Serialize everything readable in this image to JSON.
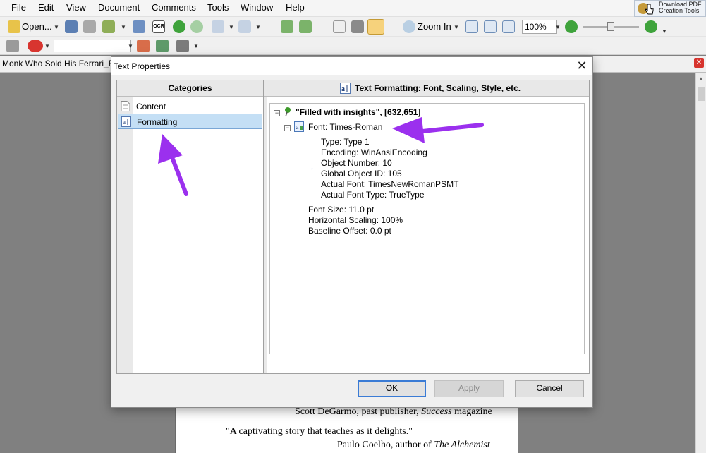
{
  "menubar": {
    "items": [
      "File",
      "Edit",
      "View",
      "Document",
      "Comments",
      "Tools",
      "Window",
      "Help"
    ],
    "download": {
      "line1": "Download PDF",
      "line2": "Creation Tools"
    }
  },
  "toolbar": {
    "open_label": "Open...",
    "zoom_in_label": "Zoom In",
    "zoom_value": "100%"
  },
  "document_tab": {
    "title": "Monk Who Sold His Ferrari_R"
  },
  "page_text": {
    "line1_plain": "Scott DeGarmo, past publisher, ",
    "line1_italic": "Success",
    "line1_end": " magazine",
    "line2": "\"A captivating story that teaches as it delights.\"",
    "line3_plain": "Paulo Coelho, author of ",
    "line3_italic": "The Alchemist"
  },
  "dialog": {
    "title": "Text Properties",
    "categories_header": "Categories",
    "categories": [
      "Content",
      "Formatting"
    ],
    "selected_category": "Formatting",
    "panel_header": "Text Formatting: Font, Scaling, Style, etc.",
    "tree": {
      "root": "\"Filled with insights\", [632,651]",
      "font_node": "Font: Times-Roman",
      "font_details": [
        "Type: Type 1",
        "Encoding: WinAnsiEncoding",
        "Object Number: 10",
        "Global Object ID: 105",
        "Actual Font: TimesNewRomanPSMT",
        "Actual Font Type: TrueType"
      ],
      "metrics": [
        "Font Size: 11.0 pt",
        "Horizontal Scaling: 100%",
        "Baseline Offset: 0.0 pt"
      ]
    },
    "buttons": {
      "ok": "OK",
      "apply": "Apply",
      "cancel": "Cancel"
    }
  },
  "colors": {
    "annotation_arrow": "#9b30ee",
    "selection_bg": "#c4dff5",
    "default_button_border": "#3a7bd5",
    "tree_pin": "#3c9a2a"
  }
}
